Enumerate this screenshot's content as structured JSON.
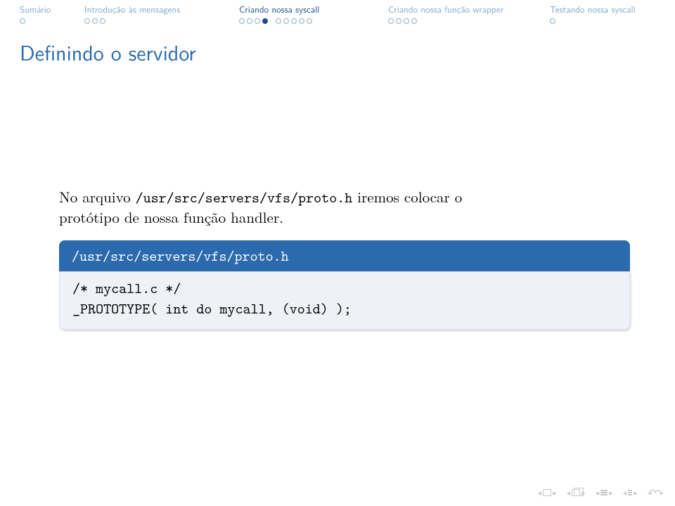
{
  "nav": {
    "sections": [
      {
        "title": "Sumário",
        "active": false,
        "dots": [
          "empty"
        ]
      },
      {
        "title": "Introdução às mensagens",
        "active": false,
        "dots": [
          "empty",
          "empty",
          "empty"
        ]
      },
      {
        "title": "Criando nossa syscall",
        "active": true,
        "dots": [
          "empty",
          "empty",
          "empty",
          "filled",
          "gap",
          "empty",
          "empty",
          "empty",
          "empty",
          "empty"
        ]
      },
      {
        "title": "Criando nossa função wrapper",
        "active": false,
        "dots": [
          "empty",
          "empty",
          "empty",
          "empty"
        ]
      },
      {
        "title": "Testando nossa syscall",
        "active": false,
        "dots": [
          "empty"
        ]
      }
    ]
  },
  "frame_title": "Definindo o servidor",
  "body": {
    "line1_pre": "No arquivo ",
    "line1_code": "/usr/src/servers/vfs/proto.h",
    "line1_post": " iremos colocar o",
    "line2": "protótipo de nossa função handler."
  },
  "block": {
    "title": "/usr/src/servers/vfs/proto.h",
    "body_line1": "/* mycall.c */",
    "body_underscore": "_",
    "body_line2_rest": "PROTOTYPE( int do mycall, (void) );"
  },
  "footer": {
    "items": [
      "slide-prev-next",
      "frame-prev-next",
      "section-prev-next",
      "subsection-prev-next",
      "back-forward",
      "search"
    ]
  }
}
